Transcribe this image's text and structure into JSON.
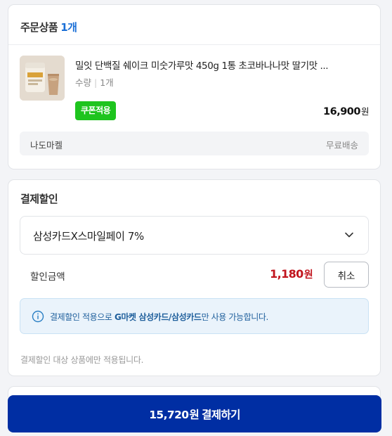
{
  "order": {
    "title": "주문상품",
    "count": "1개",
    "product": {
      "name": "밀잇 단백질 쉐이크 미숫가루맛 450g 1통 초코바나나맛 딸기맛 ...",
      "qty_label": "수량",
      "qty_value": "1개",
      "coupon_badge": "쿠폰적용",
      "price": "16,900",
      "price_unit": "원",
      "thumbnail_icon": "product-image"
    },
    "seller": {
      "name": "나도마켈",
      "shipping": "무료배송"
    }
  },
  "discount": {
    "title": "결제할인",
    "card_select": "삼성카드X스마일페이 7%",
    "amount_label": "할인금액",
    "amount": "1,180",
    "amount_unit": "원",
    "cancel_label": "취소",
    "info": {
      "prefix": "결제할인 적용으로 ",
      "highlight": "G마켓 삼성카드/삼성카드",
      "suffix": "만 사용 가능합니다."
    },
    "footnote": "결제할인 대상 상품에만 적용됩니다."
  },
  "pay": {
    "amount": "15,720",
    "unit": "원",
    "label": "결제하기"
  },
  "colors": {
    "accent_blue": "#1a6fd6",
    "coupon_green": "#1ec41e",
    "discount_red": "#c1141d",
    "pay_button": "#002ea3"
  }
}
